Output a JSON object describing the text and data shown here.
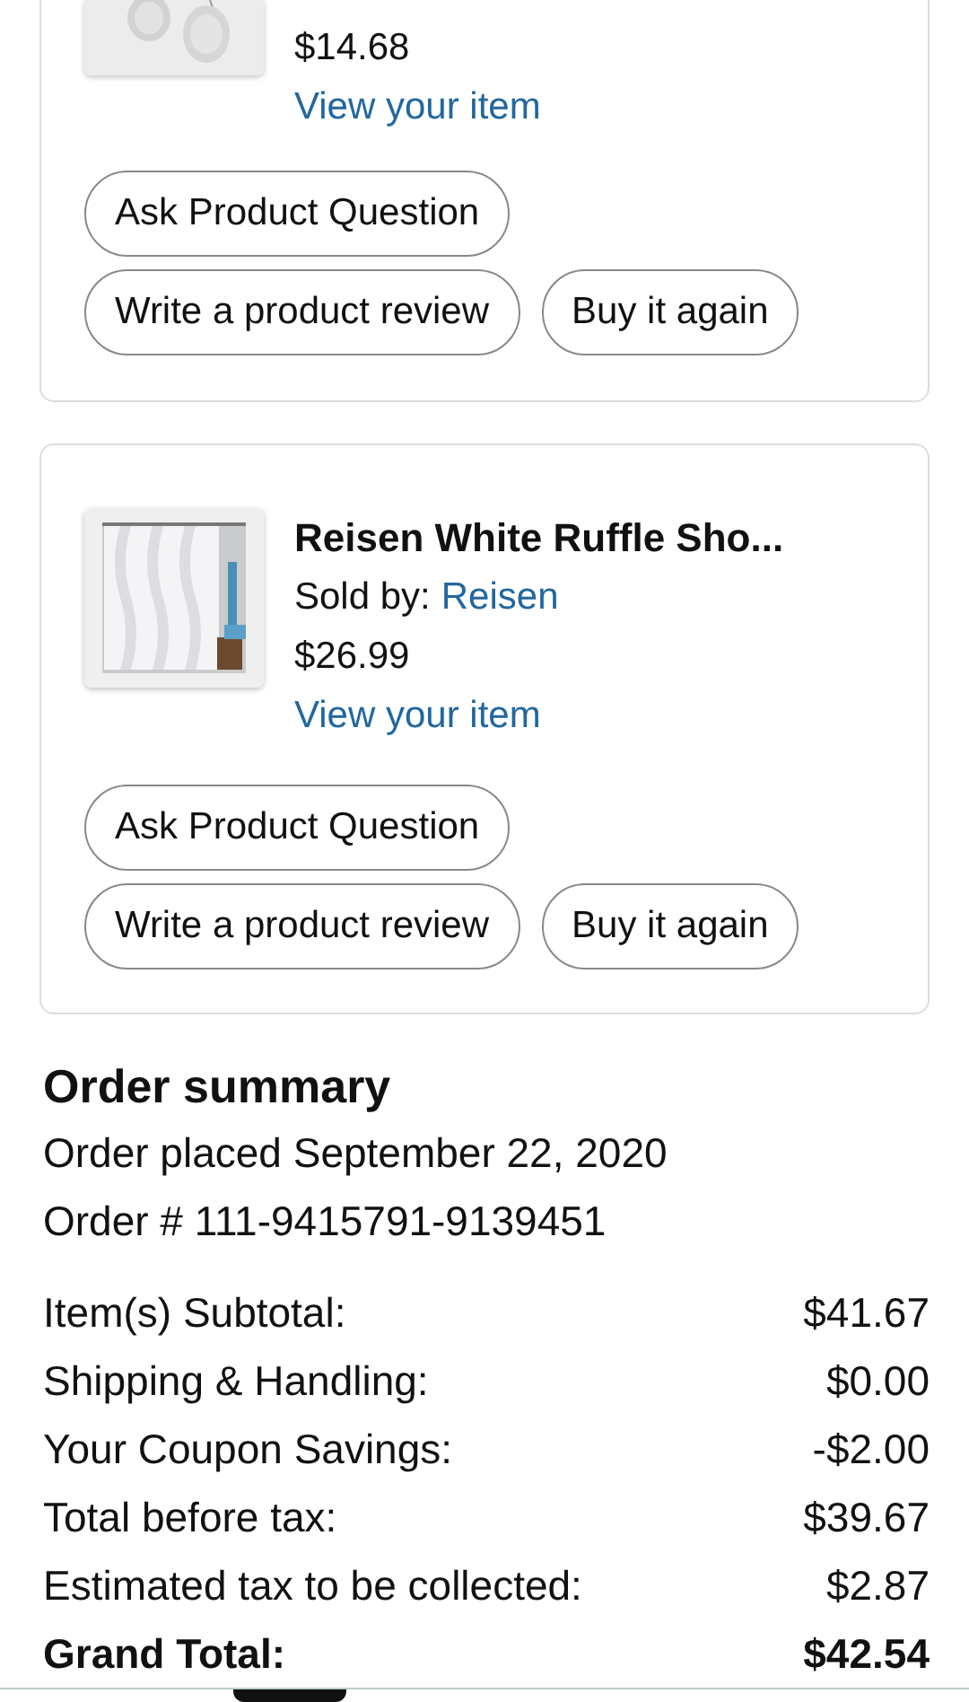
{
  "orders": [
    {
      "kind": "cut",
      "price": "$14.68",
      "view_link": "View your item",
      "button_rows": [
        [
          "Ask Product Question"
        ],
        [
          "Write a product review",
          "Buy it again"
        ]
      ]
    },
    {
      "kind": "full",
      "title": "Reisen White Ruffle Sho...",
      "sold_by_label": "Sold by:",
      "seller": "Reisen",
      "price": "$26.99",
      "view_link": "View your item",
      "button_rows": [
        [
          "Ask Product Question"
        ],
        [
          "Write a product review",
          "Buy it again"
        ]
      ]
    }
  ],
  "order_summary": {
    "title": "Order summary",
    "placed": "Order placed September 22, 2020",
    "order_number": "Order # 111-9415791-9139451",
    "lines": [
      {
        "kind": "normal",
        "label": "Item(s) Subtotal:",
        "value": "$41.67"
      },
      {
        "kind": "normal",
        "label": "Shipping & Handling:",
        "value": "$0.00"
      },
      {
        "kind": "normal",
        "label": "Your Coupon Savings:",
        "value": "-$2.00"
      },
      {
        "kind": "normal",
        "label": "Total before tax:",
        "value": "$39.67"
      },
      {
        "kind": "normal",
        "label": "Estimated tax to be collected:",
        "value": "$2.87"
      },
      {
        "kind": "total",
        "label": "Grand Total:",
        "value": "$42.54"
      }
    ]
  }
}
